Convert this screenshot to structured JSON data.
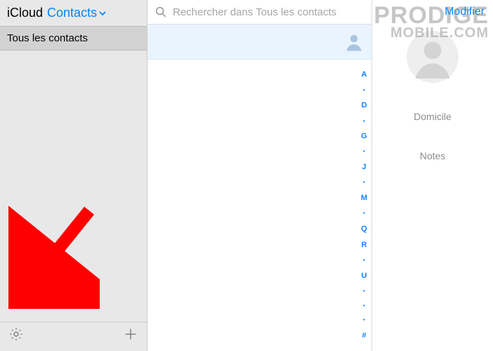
{
  "header": {
    "brand": "iCloud",
    "section": "Contacts"
  },
  "sidebar": {
    "groups": [
      {
        "label": "Tous les contacts"
      }
    ]
  },
  "search": {
    "placeholder": "Rechercher dans Tous les contacts"
  },
  "index_letters": [
    "A",
    "•",
    "D",
    "•",
    "G",
    "•",
    "J",
    "•",
    "M",
    "•",
    "Q",
    "R",
    "•",
    "U",
    "•",
    "•",
    "•",
    "#"
  ],
  "detail": {
    "edit_label": "Modifier",
    "fields": [
      {
        "label": "Domicile"
      },
      {
        "label": "Notes"
      }
    ]
  },
  "icons": {
    "chevron_down": "chevron-down-icon",
    "search": "search-icon",
    "gear": "gear-icon",
    "plus": "plus-icon",
    "avatar": "avatar-placeholder-icon",
    "contact_silhouette": "contact-silhouette-icon"
  },
  "watermark": {
    "line1": "PRODIGE",
    "line2": "MOBILE.COM"
  },
  "colors": {
    "accent": "#0084ff",
    "selection": "#eaf4ff"
  }
}
